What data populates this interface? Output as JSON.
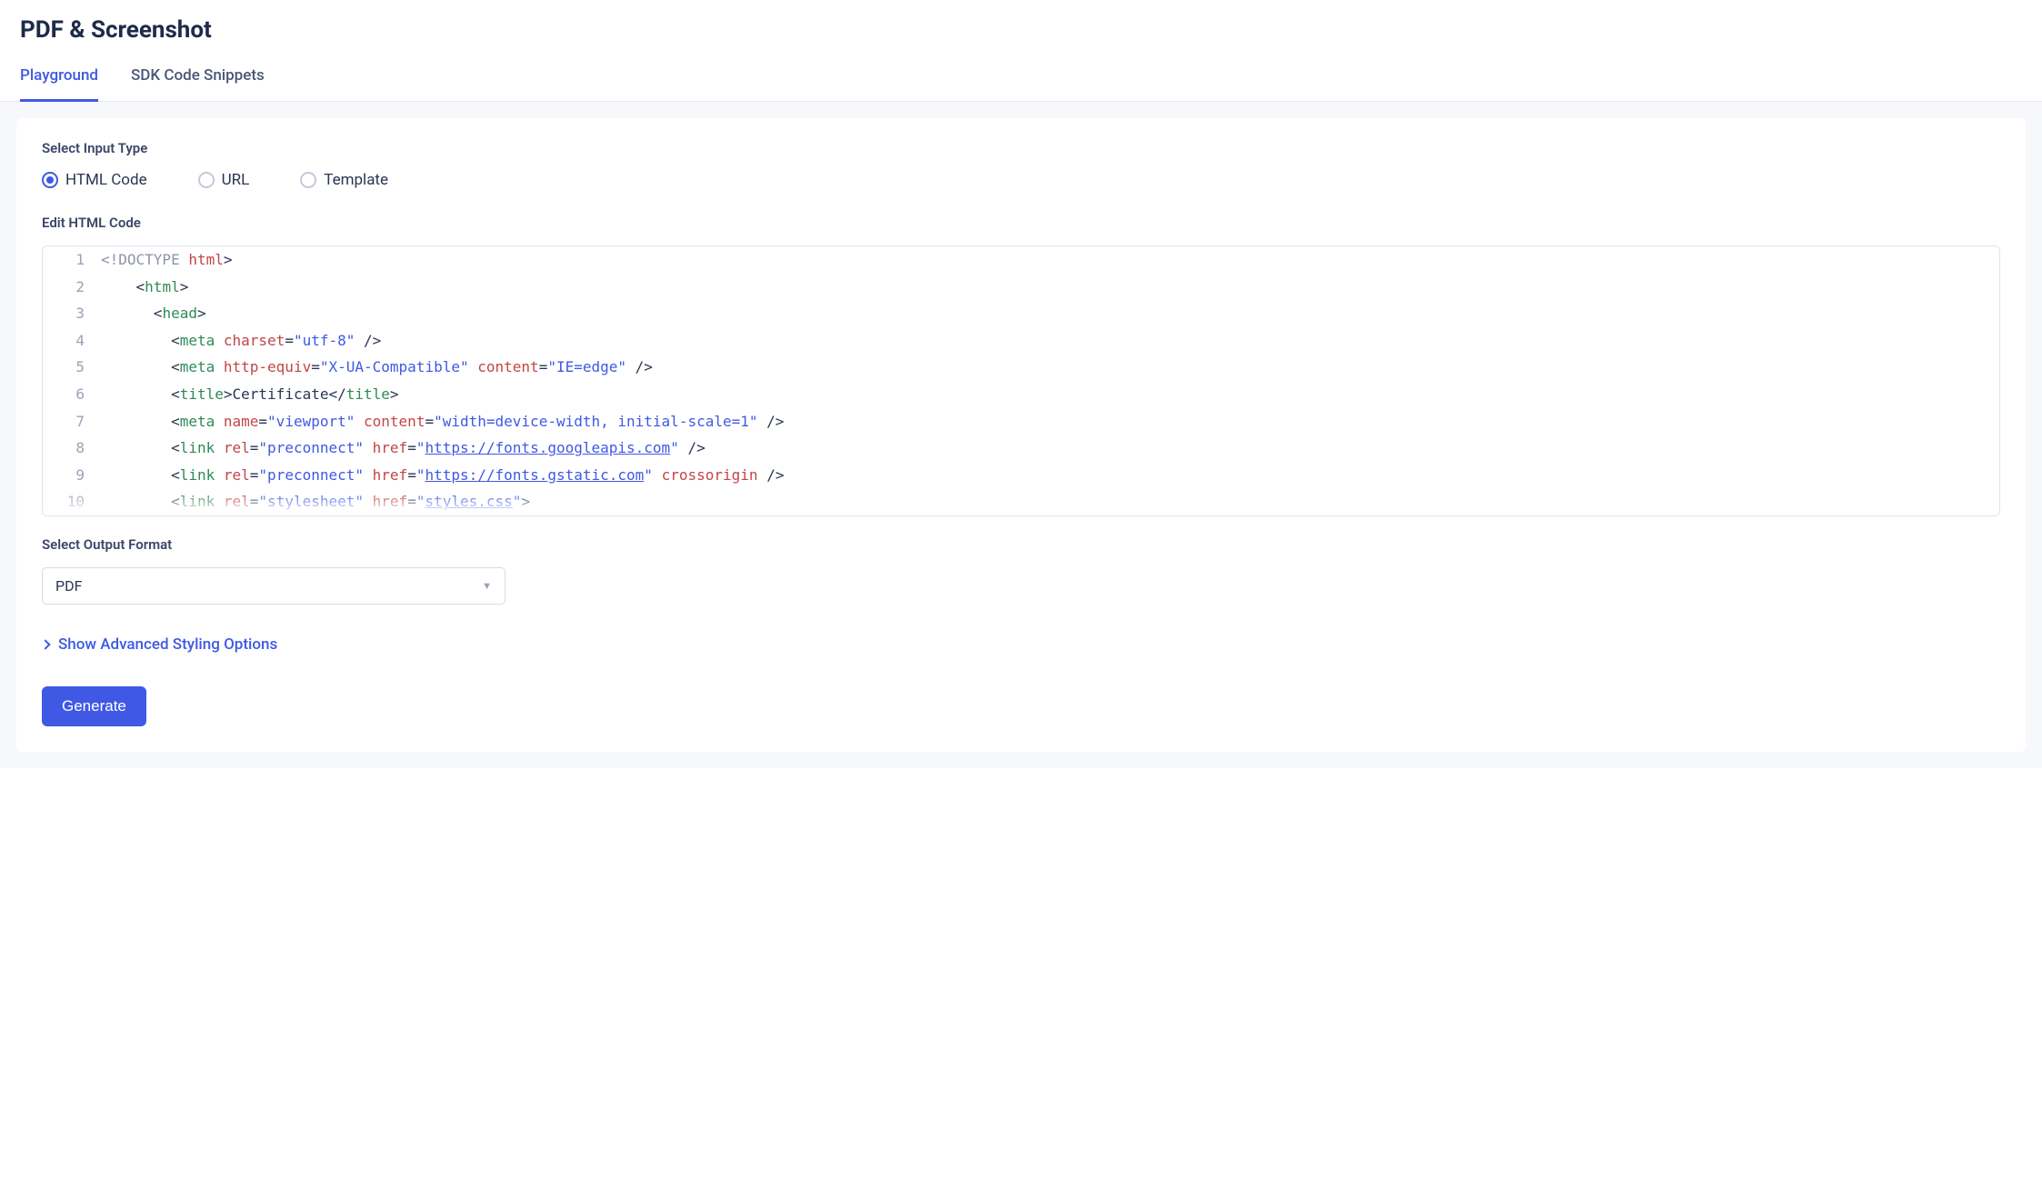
{
  "header": {
    "title": "PDF & Screenshot"
  },
  "tabs": {
    "items": [
      {
        "label": "Playground",
        "active": true
      },
      {
        "label": "SDK Code Snippets",
        "active": false
      }
    ]
  },
  "input_type": {
    "label": "Select Input Type",
    "options": [
      {
        "label": "HTML Code",
        "selected": true
      },
      {
        "label": "URL",
        "selected": false
      },
      {
        "label": "Template",
        "selected": false
      }
    ]
  },
  "editor": {
    "label": "Edit HTML Code",
    "lines": [
      {
        "n": "1",
        "tokens": [
          [
            "doctype",
            "<!DOCTYPE "
          ],
          [
            "attr",
            "html"
          ],
          [
            "bracket",
            ">"
          ]
        ]
      },
      {
        "n": "2",
        "indent": 4,
        "tokens": [
          [
            "bracket",
            "<"
          ],
          [
            "tag",
            "html"
          ],
          [
            "bracket",
            ">"
          ]
        ]
      },
      {
        "n": "3",
        "indent": 6,
        "tokens": [
          [
            "bracket",
            "<"
          ],
          [
            "tag",
            "head"
          ],
          [
            "bracket",
            ">"
          ]
        ]
      },
      {
        "n": "4",
        "indent": 8,
        "tokens": [
          [
            "bracket",
            "<"
          ],
          [
            "tag",
            "meta"
          ],
          [
            "text",
            " "
          ],
          [
            "attr",
            "charset"
          ],
          [
            "punct",
            "="
          ],
          [
            "str",
            "\"utf-8\""
          ],
          [
            "text",
            " "
          ],
          [
            "bracket",
            "/>"
          ]
        ]
      },
      {
        "n": "5",
        "indent": 8,
        "tokens": [
          [
            "bracket",
            "<"
          ],
          [
            "tag",
            "meta"
          ],
          [
            "text",
            " "
          ],
          [
            "attr",
            "http-equiv"
          ],
          [
            "punct",
            "="
          ],
          [
            "str",
            "\"X-UA-Compatible\""
          ],
          [
            "text",
            " "
          ],
          [
            "attr",
            "content"
          ],
          [
            "punct",
            "="
          ],
          [
            "str",
            "\"IE=edge\""
          ],
          [
            "text",
            " "
          ],
          [
            "bracket",
            "/>"
          ]
        ]
      },
      {
        "n": "6",
        "indent": 8,
        "tokens": [
          [
            "bracket",
            "<"
          ],
          [
            "tag",
            "title"
          ],
          [
            "bracket",
            ">"
          ],
          [
            "text",
            "Certificate"
          ],
          [
            "bracket",
            "</"
          ],
          [
            "tag",
            "title"
          ],
          [
            "bracket",
            ">"
          ]
        ]
      },
      {
        "n": "7",
        "indent": 8,
        "tokens": [
          [
            "bracket",
            "<"
          ],
          [
            "tag",
            "meta"
          ],
          [
            "text",
            " "
          ],
          [
            "attr",
            "name"
          ],
          [
            "punct",
            "="
          ],
          [
            "str",
            "\"viewport\""
          ],
          [
            "text",
            " "
          ],
          [
            "attr",
            "content"
          ],
          [
            "punct",
            "="
          ],
          [
            "str",
            "\"width=device-width, initial-scale=1\""
          ],
          [
            "text",
            " "
          ],
          [
            "bracket",
            "/>"
          ]
        ]
      },
      {
        "n": "8",
        "indent": 8,
        "tokens": [
          [
            "bracket",
            "<"
          ],
          [
            "tag",
            "link"
          ],
          [
            "text",
            " "
          ],
          [
            "attr",
            "rel"
          ],
          [
            "punct",
            "="
          ],
          [
            "str",
            "\"preconnect\""
          ],
          [
            "text",
            " "
          ],
          [
            "attr",
            "href"
          ],
          [
            "punct",
            "="
          ],
          [
            "str",
            "\""
          ],
          [
            "link",
            "https://fonts.googleapis.com"
          ],
          [
            "str",
            "\""
          ],
          [
            "text",
            " "
          ],
          [
            "bracket",
            "/>"
          ]
        ]
      },
      {
        "n": "9",
        "indent": 8,
        "tokens": [
          [
            "bracket",
            "<"
          ],
          [
            "tag",
            "link"
          ],
          [
            "text",
            " "
          ],
          [
            "attr",
            "rel"
          ],
          [
            "punct",
            "="
          ],
          [
            "str",
            "\"preconnect\""
          ],
          [
            "text",
            " "
          ],
          [
            "attr",
            "href"
          ],
          [
            "punct",
            "="
          ],
          [
            "str",
            "\""
          ],
          [
            "link",
            "https://fonts.gstatic.com"
          ],
          [
            "str",
            "\""
          ],
          [
            "text",
            " "
          ],
          [
            "attr",
            "crossorigin"
          ],
          [
            "text",
            " "
          ],
          [
            "bracket",
            "/>"
          ]
        ]
      },
      {
        "n": "10",
        "indent": 8,
        "tokens": [
          [
            "bracket",
            "<"
          ],
          [
            "tag",
            "link"
          ],
          [
            "text",
            " "
          ],
          [
            "attr",
            "rel"
          ],
          [
            "punct",
            "="
          ],
          [
            "str",
            "\"stylesheet\""
          ],
          [
            "text",
            " "
          ],
          [
            "attr",
            "href"
          ],
          [
            "punct",
            "="
          ],
          [
            "str",
            "\""
          ],
          [
            "link",
            "styles.css"
          ],
          [
            "str",
            "\""
          ],
          [
            "bracket",
            ">"
          ]
        ]
      }
    ]
  },
  "output_format": {
    "label": "Select Output Format",
    "selected": "PDF"
  },
  "advanced": {
    "toggle_label": "Show Advanced Styling Options"
  },
  "actions": {
    "generate": "Generate"
  }
}
